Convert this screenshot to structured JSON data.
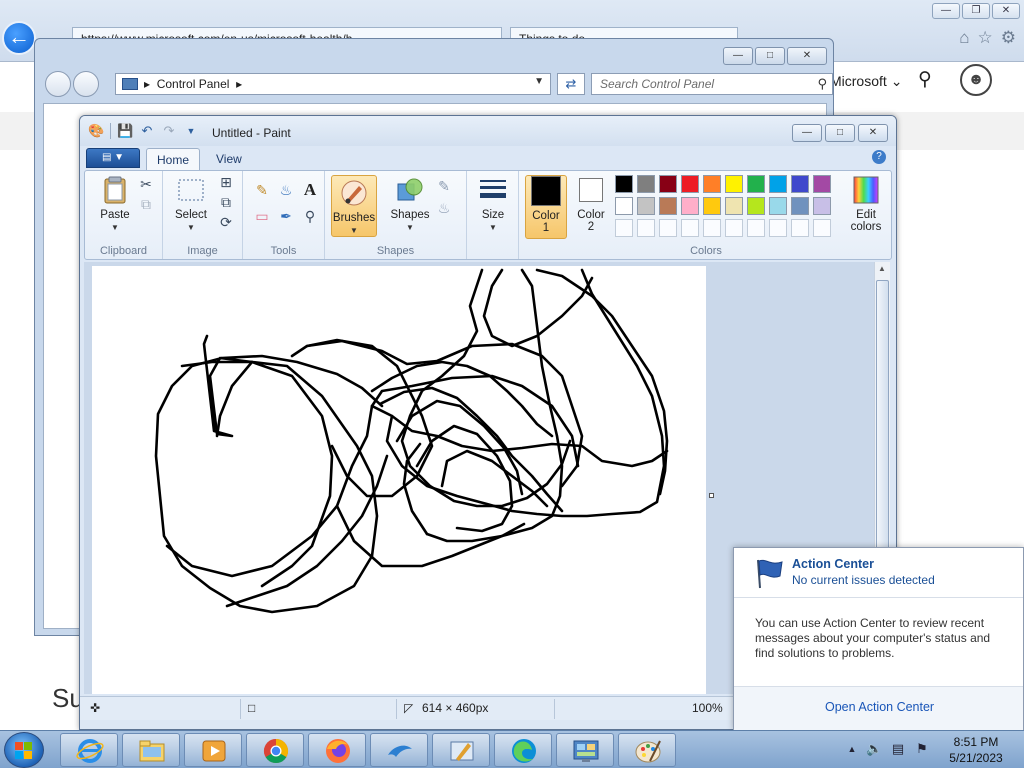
{
  "browser": {
    "tab1_text": "https://www.microsoft.com/en-us/microsoft-health/h...",
    "tab2_text": "Things to do ...",
    "brand_partial": "Microsoft",
    "page_heading_partial": "Su"
  },
  "control_panel": {
    "breadcrumb": "Control Panel",
    "search_placeholder": "Search Control Panel"
  },
  "paint": {
    "window_title": "Untitled - Paint",
    "tabs": [
      {
        "label": "Home",
        "active": true
      },
      {
        "label": "View",
        "active": false
      }
    ],
    "groups": {
      "clipboard": {
        "label": "Clipboard",
        "paste": "Paste"
      },
      "image": {
        "label": "Image",
        "select": "Select"
      },
      "tools": {
        "label": "Tools"
      },
      "shapes": {
        "label": "Shapes",
        "brushes": "Brushes",
        "shapes": "Shapes"
      },
      "size": {
        "label": "Size"
      },
      "colors": {
        "label": "Colors",
        "color1_line1": "Color",
        "color1_line2": "1",
        "color2_line1": "Color",
        "color2_line2": "2",
        "edit_line1": "Edit",
        "edit_line2": "colors",
        "color1_value": "#000000",
        "color2_value": "#ffffff",
        "palette_row1": [
          "#000000",
          "#7f7f7f",
          "#880015",
          "#ed1c24",
          "#ff7f27",
          "#fff200",
          "#22b14c",
          "#00a2e8",
          "#3f48cc",
          "#a349a4"
        ],
        "palette_row2": [
          "#ffffff",
          "#c3c3c3",
          "#b97a57",
          "#ffaec9",
          "#ffc90e",
          "#efe4b0",
          "#b5e61d",
          "#99d9ea",
          "#7092be",
          "#c8bfe7"
        ]
      }
    },
    "status": {
      "canvas_size": "614 × 460px",
      "zoom": "100%"
    }
  },
  "action_center": {
    "title": "Action Center",
    "subtitle": "No current issues detected",
    "body": "You can use Action Center to review recent messages about your computer's status and find solutions to problems.",
    "link": "Open Action Center"
  },
  "taskbar": {
    "time": "8:51 PM",
    "date": "5/21/2023",
    "apps": [
      "Internet Explorer",
      "File Explorer",
      "Windows Media Player",
      "Google Chrome",
      "Firefox",
      "Dolphin",
      "Paint.NET",
      "Microsoft Edge",
      "Control Panel",
      "Paint"
    ]
  },
  "colors": {
    "accent_blue": "#1a4f96",
    "link_blue": "#1a56b8",
    "ribbon_highlight": "#f6c66a"
  }
}
